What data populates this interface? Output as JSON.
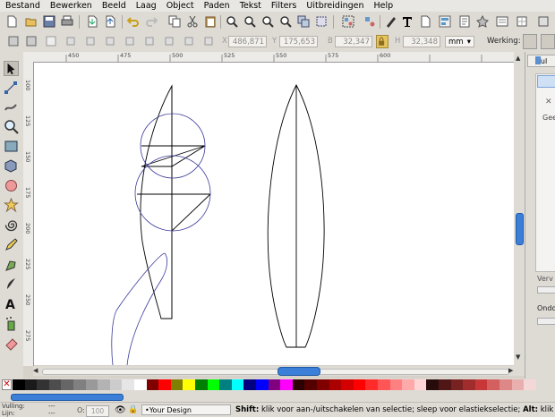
{
  "menubar": {
    "items": [
      "Bestand",
      "Bewerken",
      "Beeld",
      "Laag",
      "Object",
      "Paden",
      "Tekst",
      "Filters",
      "Uitbreidingen",
      "Help"
    ]
  },
  "controls": {
    "x_label": "X",
    "x_value": "486,871",
    "y_label": "Y",
    "y_value": "175,653",
    "w_label": "B",
    "w_value": "32,347",
    "h_label": "H",
    "h_value": "32,348",
    "unit": "mm",
    "werking_label": "Werking:"
  },
  "ruler": {
    "h_ticks": [
      "450",
      "475",
      "500",
      "525",
      "550",
      "575",
      "600"
    ],
    "v_ticks": [
      "100",
      "125",
      "150",
      "175",
      "200",
      "225",
      "250",
      "275",
      "300"
    ]
  },
  "dock": {
    "tab_label": "Vul",
    "gee_label": "Gee",
    "verv_label": "Verv",
    "ondo_label": "Ondo"
  },
  "palette": {
    "colors": [
      "#000000",
      "#1a1a1a",
      "#333333",
      "#4d4d4d",
      "#666666",
      "#808080",
      "#999999",
      "#b3b3b3",
      "#cccccc",
      "#e6e6e6",
      "#ffffff",
      "#800000",
      "#ff0000",
      "#808000",
      "#ffff00",
      "#008000",
      "#00ff00",
      "#008080",
      "#00ffff",
      "#000080",
      "#0000ff",
      "#800080",
      "#ff00ff",
      "#2b0000",
      "#550000",
      "#800000",
      "#aa0000",
      "#d40000",
      "#ff0000",
      "#ff2a2a",
      "#ff5555",
      "#ff8080",
      "#ffaaaa",
      "#ffd5d5",
      "#280b0b",
      "#501616",
      "#782121",
      "#a02c2c",
      "#c83737",
      "#d35f5f",
      "#de8787",
      "#e9afaf",
      "#f4d7d7"
    ]
  },
  "status": {
    "fill_label": "Vulling:",
    "stroke_label": "Lijn:",
    "fill_value": "---",
    "stroke_value": "---",
    "opacity_label": "O:",
    "opacity_value": "100",
    "layer": "•Your Design",
    "hint_bold": "Shift:",
    "hint_text": " klik voor aan-/uitschakelen van selectie; sleep voor elastiekselectie; ",
    "hint_bold2": "Alt:",
    "hint_text2": " klik"
  }
}
